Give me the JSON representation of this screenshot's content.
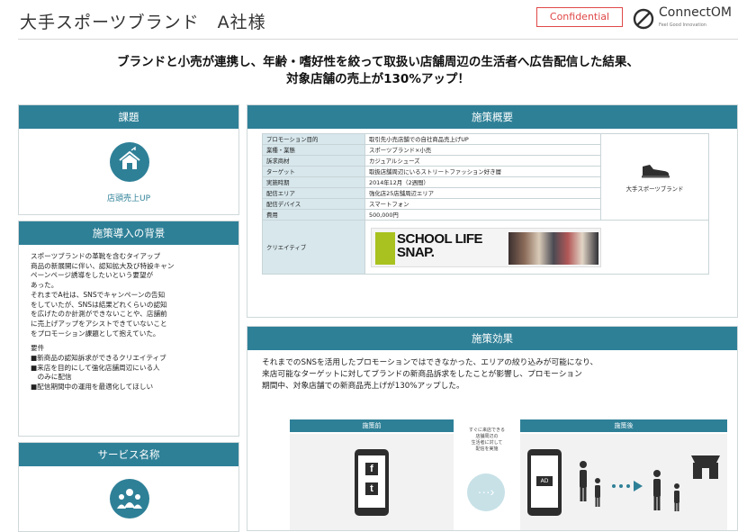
{
  "header": {
    "title": "大手スポーツブランド　A社様",
    "confidential": "Confidential",
    "logo_text": "ConnectOM",
    "logo_sub": "Feel Good Innovation"
  },
  "headline": {
    "line1": "ブランドと小売が連携し、年齢・嗜好性を絞って取扱い店舗周辺の生活者へ広告配信した結果、",
    "line2": "対象店舗の売上が130%アップ！"
  },
  "issue": {
    "title": "課題",
    "caption": "店頭売上UP"
  },
  "background": {
    "title": "施策導入の背景",
    "paragraphs": [
      "スポーツブランドの革靴を含むタイアップ",
      "商品の新展開に伴い、認知拡大及び特設キャン",
      "ペーンページ誘導をしたいという要望が",
      "あった。",
      "それまでA社は、SNSでキャンペーンの告知",
      "をしていたが、SNSは結果どれくらいの認知",
      "を広げたのか計測ができないことや、店舗前",
      "に売上げアップをアシストできていないこと",
      "をプロモーション課題として抱えていた。"
    ],
    "req_title": "要件",
    "requirements": [
      "■新商品の認知訴求ができるクリエイティブ",
      "■来店を目的にして強化店舗周辺にいる人",
      "　のみに配信",
      "■配信期間中の運用を最適化してほしい"
    ]
  },
  "service": {
    "title": "サービス名称"
  },
  "overview": {
    "title": "施策概要",
    "rows": [
      {
        "label": "プロモーション目的",
        "value": "取引先小売店舗での自社商品売上げUP"
      },
      {
        "label": "業種・業態",
        "value": "スポーツブランド×小売"
      },
      {
        "label": "訴求商材",
        "value": "カジュアルシューズ"
      },
      {
        "label": "ターゲット",
        "value": "取扱店舗周辺にいるストリートファッション好き層"
      },
      {
        "label": "実施時期",
        "value": "2014年12月（2週間）"
      },
      {
        "label": "配信エリア",
        "value": "強化店25店舗周辺エリア"
      },
      {
        "label": "配信デバイス",
        "value": "スマートフォン"
      },
      {
        "label": "費用",
        "value": "500,000円"
      }
    ],
    "brand": "大手スポーツブランド",
    "creative_label": "クリエイティブ",
    "banner_line1": "SCHOOL LIFE",
    "banner_line2": "SNAP."
  },
  "result": {
    "title": "施策効果",
    "lines": [
      "それまでのSNSを活用したプロモーションではできなかった、エリアの絞り込みが可能になり、",
      "来店可能なターゲットに対してブランドの新商品訴求をしたことが影響し、プロモーション",
      "期間中、対象店舗での新商品売上げが130%アップした。"
    ],
    "before_label": "施策前",
    "after_label": "施策後",
    "mid_text": [
      "すぐに来店できる",
      "店舗周辺の",
      "生活者に対して",
      "配信を実施"
    ],
    "ad_label": "AD",
    "sns_icons": [
      "f",
      "t"
    ]
  },
  "colors": {
    "accent": "#2e8097",
    "label_bg": "#d7e7ec",
    "confidential": "#e04848"
  }
}
